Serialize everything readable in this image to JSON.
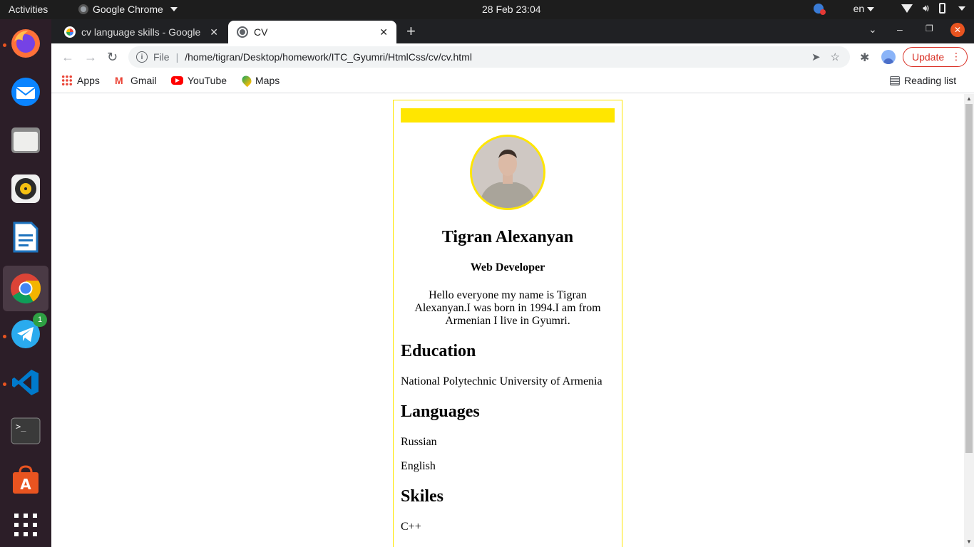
{
  "os": {
    "activities": "Activities",
    "app_name": "Google Chrome",
    "clock": "28 Feb  23:04",
    "language": "en"
  },
  "dock": {
    "items": [
      "Firefox",
      "Thunderbird",
      "Files",
      "Rhythmbox",
      "LibreOffice Writer",
      "Google Chrome",
      "Telegram",
      "Visual Studio Code",
      "Terminal",
      "Ubuntu Software",
      "Show Applications"
    ],
    "telegram_badge": "1"
  },
  "browser": {
    "tabs": [
      {
        "title": "cv language skills - Google"
      },
      {
        "title": "CV"
      }
    ],
    "omnibox": {
      "scheme": "File",
      "url": "/home/tigran/Desktop/homework/ITC_Gyumri/HtmlCss/cv/cv.html"
    },
    "update_label": "Update",
    "bookmarks": [
      "Apps",
      "Gmail",
      "YouTube",
      "Maps"
    ],
    "reading_list": "Reading list"
  },
  "cv": {
    "name": "Tigran Alexanyan",
    "role": "Web Developer",
    "bio": "Hello everyone my name is Tigran Alexanyan.I was born in 1994.I am from Armenian I live in Gyumri.",
    "education_heading": "Education",
    "education": "National Polytechnic University of Armenia",
    "languages_heading": "Languages",
    "languages": [
      "Russian",
      "English"
    ],
    "skills_heading": "Skiles",
    "skills": [
      "C++"
    ]
  },
  "colors": {
    "accent": "#ffe600",
    "dock_bg": "#2c1e28",
    "topbar_bg": "#1d1d1d",
    "update_red": "#d93025"
  }
}
